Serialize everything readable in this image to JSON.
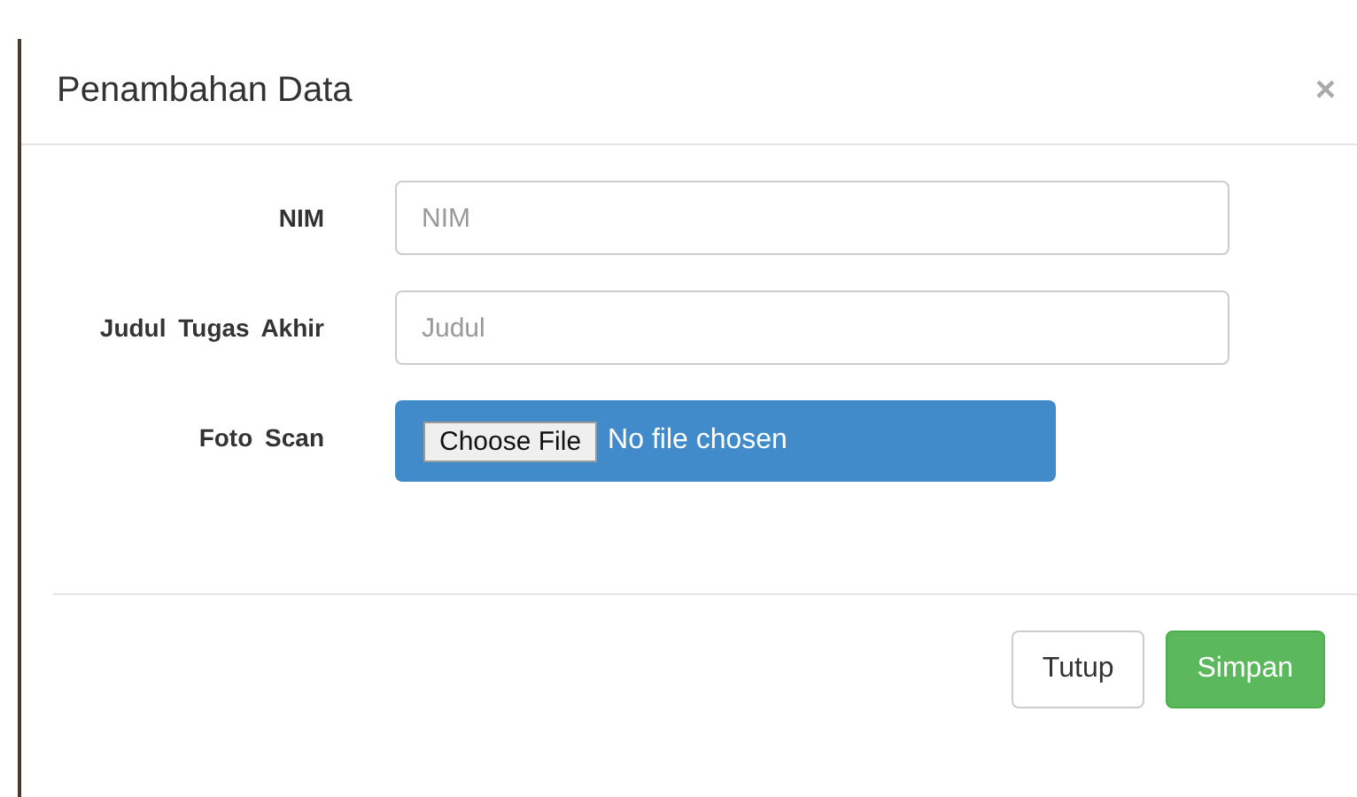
{
  "dialog": {
    "title": "Penambahan Data",
    "close": "×"
  },
  "fields": [
    {
      "kind": "text",
      "label": "NIM",
      "placeholder": "NIM"
    },
    {
      "kind": "text",
      "label": "Judul Tugas Akhir",
      "placeholder": "Judul"
    },
    {
      "kind": "file",
      "label": "Foto Scan",
      "button": "Choose File",
      "status": "No file chosen"
    }
  ],
  "buttons": [
    {
      "label": "Tutup",
      "kind": "default"
    },
    {
      "label": "Simpan",
      "kind": "success"
    }
  ]
}
